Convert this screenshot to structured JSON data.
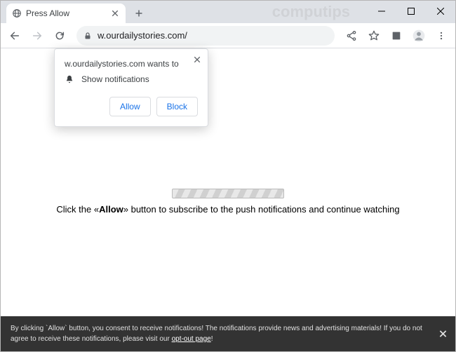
{
  "window": {
    "watermark": "computips"
  },
  "tab": {
    "title": "Press Allow"
  },
  "omnibox": {
    "url": "w.ourdailystories.com/"
  },
  "notif": {
    "origin_text": "w.ourdailystories.com wants to",
    "permission": "Show notifications",
    "allow": "Allow",
    "block": "Block"
  },
  "page": {
    "message_pre": "Click the «",
    "message_bold": "Allow",
    "message_post": "» button to subscribe to the push notifications and continue watching"
  },
  "consent": {
    "text_a": "By clicking `Allow` button, you consent to receive notifications! The notifications provide news and advertising materials! If you do not agree to receive these notifications, please visit our ",
    "link": "opt-out page",
    "text_b": "!"
  }
}
